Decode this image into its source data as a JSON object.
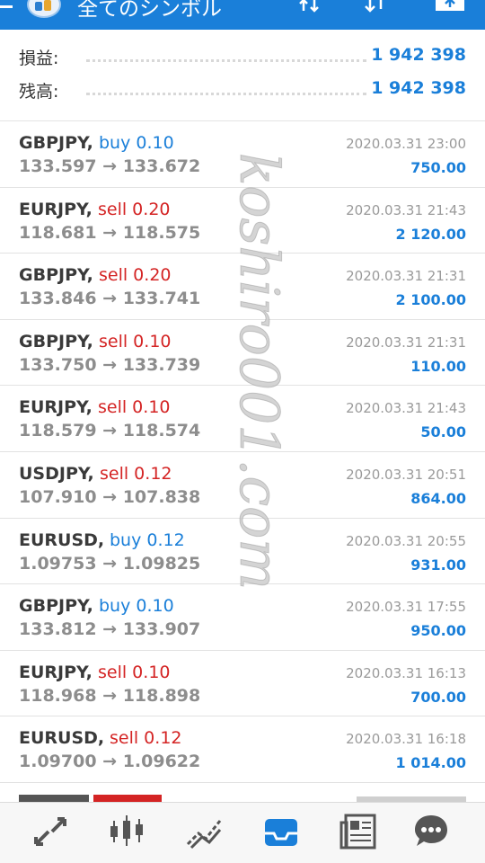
{
  "header": {
    "title": "全てのシンボル",
    "menu_icon": "hamburger-icon",
    "logo_icon": "app-logo",
    "actions": [
      "swap-icon",
      "sort-icon",
      "export-icon"
    ]
  },
  "summary": [
    {
      "label": "損益:",
      "value": "1 942 398"
    },
    {
      "label": "残高:",
      "value": "1 942 398"
    }
  ],
  "trades": [
    {
      "symbol": "GBPJPY,",
      "type": "buy 0.10",
      "side": "buy",
      "prices": "133.597 → 133.672",
      "date": "2020.03.31 23:00",
      "profit": "750.00"
    },
    {
      "symbol": "EURJPY,",
      "type": "sell 0.20",
      "side": "sell",
      "prices": "118.681 → 118.575",
      "date": "2020.03.31 21:43",
      "profit": "2 120.00"
    },
    {
      "symbol": "GBPJPY,",
      "type": "sell 0.20",
      "side": "sell",
      "prices": "133.846 → 133.741",
      "date": "2020.03.31 21:31",
      "profit": "2 100.00"
    },
    {
      "symbol": "GBPJPY,",
      "type": "sell 0.10",
      "side": "sell",
      "prices": "133.750 → 133.739",
      "date": "2020.03.31 21:31",
      "profit": "110.00"
    },
    {
      "symbol": "EURJPY,",
      "type": "sell 0.10",
      "side": "sell",
      "prices": "118.579 → 118.574",
      "date": "2020.03.31 21:43",
      "profit": "50.00"
    },
    {
      "symbol": "USDJPY,",
      "type": "sell 0.12",
      "side": "sell",
      "prices": "107.910 → 107.838",
      "date": "2020.03.31 20:51",
      "profit": "864.00"
    },
    {
      "symbol": "EURUSD,",
      "type": "buy 0.12",
      "side": "buy",
      "prices": "1.09753 → 1.09825",
      "date": "2020.03.31 20:55",
      "profit": "931.00"
    },
    {
      "symbol": "GBPJPY,",
      "type": "buy 0.10",
      "side": "buy",
      "prices": "133.812 → 133.907",
      "date": "2020.03.31 17:55",
      "profit": "950.00"
    },
    {
      "symbol": "EURJPY,",
      "type": "sell 0.10",
      "side": "sell",
      "prices": "118.968 → 118.898",
      "date": "2020.03.31 16:13",
      "profit": "700.00"
    },
    {
      "symbol": "EURUSD,",
      "type": "sell 0.12",
      "side": "sell",
      "prices": "1.09700 → 1.09622",
      "date": "2020.03.31 16:18",
      "profit": "1 014.00"
    }
  ],
  "watermark": "koshiro001.com",
  "bottom_nav": [
    {
      "icon": "trade-arrows-icon",
      "active": false
    },
    {
      "icon": "candlestick-chart-icon",
      "active": false
    },
    {
      "icon": "trend-line-icon",
      "active": false
    },
    {
      "icon": "inbox-history-icon",
      "active": true
    },
    {
      "icon": "news-icon",
      "active": false
    },
    {
      "icon": "chat-bubble-icon",
      "active": false
    }
  ],
  "colors": {
    "accent": "#1a7fd9",
    "sell": "#d42424",
    "nav_inactive": "#555555"
  }
}
